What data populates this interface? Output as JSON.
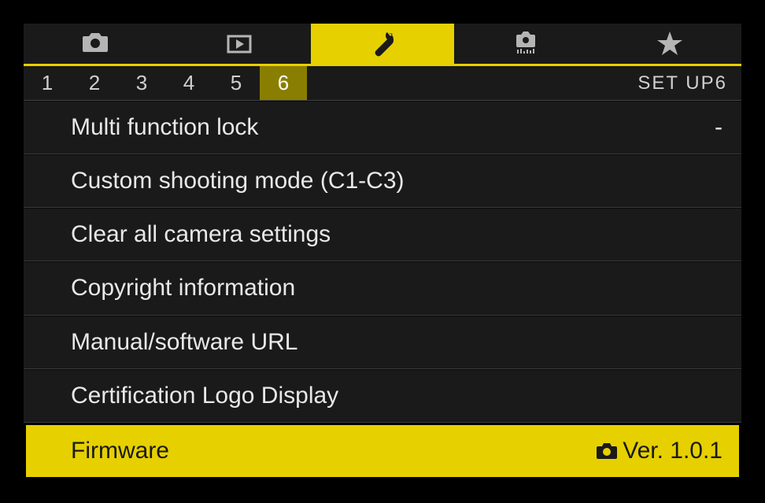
{
  "tabs": {
    "active_index": 2
  },
  "pages": {
    "numbers": [
      "1",
      "2",
      "3",
      "4",
      "5",
      "6"
    ],
    "active_index": 5,
    "label": "SET UP6"
  },
  "menu": {
    "items": [
      {
        "label": "Multi function lock",
        "value": "-"
      },
      {
        "label": "Custom shooting mode (C1-C3)",
        "value": ""
      },
      {
        "label": "Clear all camera settings",
        "value": ""
      },
      {
        "label": "Copyright information",
        "value": ""
      },
      {
        "label": "Manual/software URL",
        "value": ""
      },
      {
        "label": "Certification Logo Display",
        "value": ""
      },
      {
        "label": "Firmware",
        "value": "Ver. 1.0.1",
        "icon": "camera"
      }
    ],
    "selected_index": 6
  },
  "colors": {
    "accent": "#e6d000",
    "bg": "#1a1a1a"
  }
}
